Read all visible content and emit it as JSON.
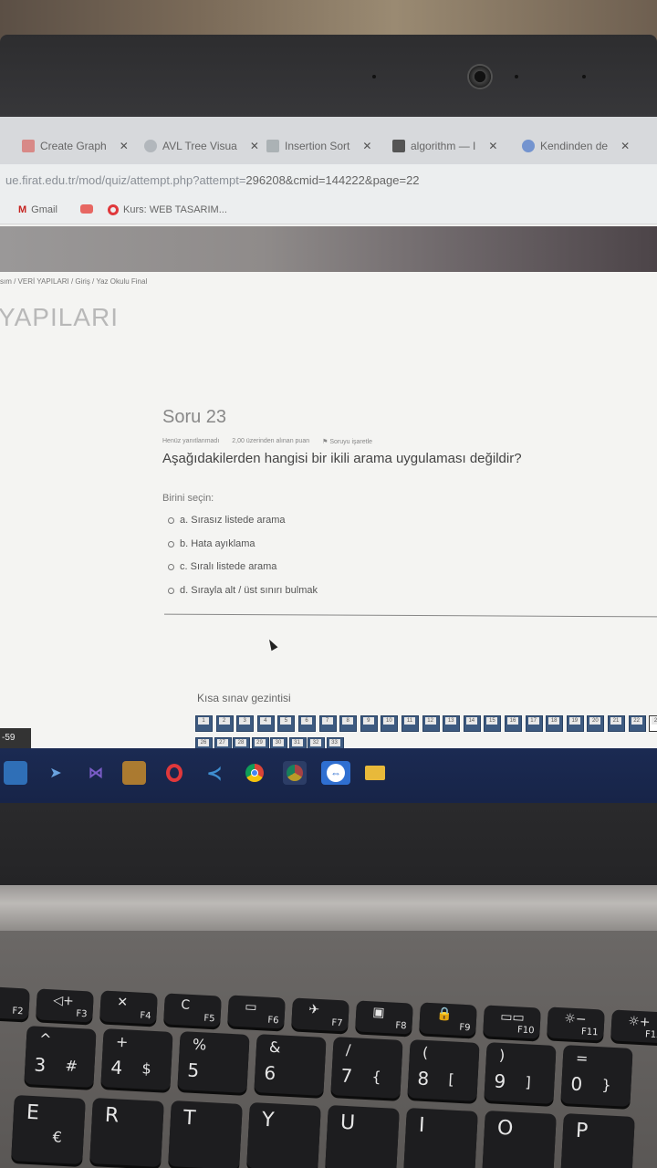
{
  "browser": {
    "tabs": [
      {
        "label": "Create Graph",
        "icon_color": "#d9534f"
      },
      {
        "label": "AVL Tree Visua",
        "icon_color": "#9aa0a6"
      },
      {
        "label": "Insertion Sort",
        "icon_color": "#7f8c8d"
      },
      {
        "label": "algorithm — I",
        "icon_color": "#555555"
      },
      {
        "label": "Kendinden de",
        "icon_color": "#4a76c9"
      }
    ],
    "url": {
      "host": "ue.firat.edu.tr",
      "path": "/mod/quiz/attempt.php?attempt=",
      "query": "296208&cmid=144222&page=22"
    },
    "bookmarks": [
      "Gmail",
      "Kurs: WEB TASARIM..."
    ]
  },
  "page": {
    "breadcrumb": "sım / VERİ YAPILARI / Giriş / Yaz Okulu Final",
    "course_title": "YAPILARI"
  },
  "question": {
    "title": "Soru 23",
    "status": "Henüz yanıtlanmadı",
    "points": "2,00 üzerinden alınan puan",
    "flag": "Soruyu işaretle",
    "text": "Aşağıdakilerden hangisi bir ikili arama uygulaması değildir?",
    "prompt": "Birini seçin:",
    "options": [
      "a. Sırasız listede arama",
      "b. Hata ayıklama",
      "c. Sıralı listede arama",
      "d. Sırayla alt / üst sınırı bulmak"
    ]
  },
  "navigation": {
    "title": "Kısa sınav gezintisi",
    "row1": [
      "1",
      "2",
      "3",
      "4",
      "5",
      "6",
      "7",
      "8",
      "9",
      "10",
      "11",
      "12",
      "13",
      "14",
      "15",
      "16",
      "17",
      "18",
      "19",
      "20",
      "21",
      "22",
      "23"
    ],
    "row2": [
      "26",
      "27",
      "28",
      "29",
      "30",
      "31",
      "32",
      "33"
    ],
    "current": "23"
  },
  "timer": "-59",
  "taskbar_icons": [
    "file-explorer-icon",
    "folder-icon",
    "visual-studio-icon",
    "paint-icon",
    "opera-icon",
    "vscode-icon",
    "chrome-icon",
    "chrome-profile-icon",
    "teamviewer-icon",
    "folder-yellow-icon"
  ],
  "keyboard": {
    "fn_row": [
      {
        "main": "",
        "fn": "F2"
      },
      {
        "main": "◁+",
        "fn": "F3"
      },
      {
        "main": "✕",
        "fn": "F4"
      },
      {
        "main": "C",
        "fn": "F5"
      },
      {
        "main": "▭",
        "fn": "F6"
      },
      {
        "main": "✈",
        "fn": "F7"
      },
      {
        "main": "▣",
        "fn": "F8"
      },
      {
        "main": "🔒",
        "fn": "F9"
      },
      {
        "main": "▭▭",
        "fn": "F10"
      },
      {
        "main": "☼−",
        "fn": "F11"
      },
      {
        "main": "☼+",
        "fn": "F12"
      }
    ],
    "num_row": [
      {
        "top": "^",
        "main": "3",
        "alt": "#"
      },
      {
        "top": "+",
        "main": "4",
        "alt": "$"
      },
      {
        "top": "%",
        "main": "5",
        "alt": ""
      },
      {
        "top": "&",
        "main": "6",
        "alt": ""
      },
      {
        "top": "/",
        "main": "7",
        "alt": "{"
      },
      {
        "top": "(",
        "main": "8",
        "alt": "["
      },
      {
        "top": ")",
        "main": "9",
        "alt": "]"
      },
      {
        "top": "=",
        "main": "0",
        "alt": "}"
      }
    ],
    "letter_row": [
      {
        "main": "E",
        "alt": "€"
      },
      {
        "main": "R",
        "alt": ""
      },
      {
        "main": "T",
        "alt": ""
      },
      {
        "main": "Y",
        "alt": ""
      },
      {
        "main": "U",
        "alt": ""
      },
      {
        "main": "I",
        "alt": ""
      },
      {
        "main": "O",
        "alt": ""
      },
      {
        "main": "P",
        "alt": ""
      }
    ]
  }
}
